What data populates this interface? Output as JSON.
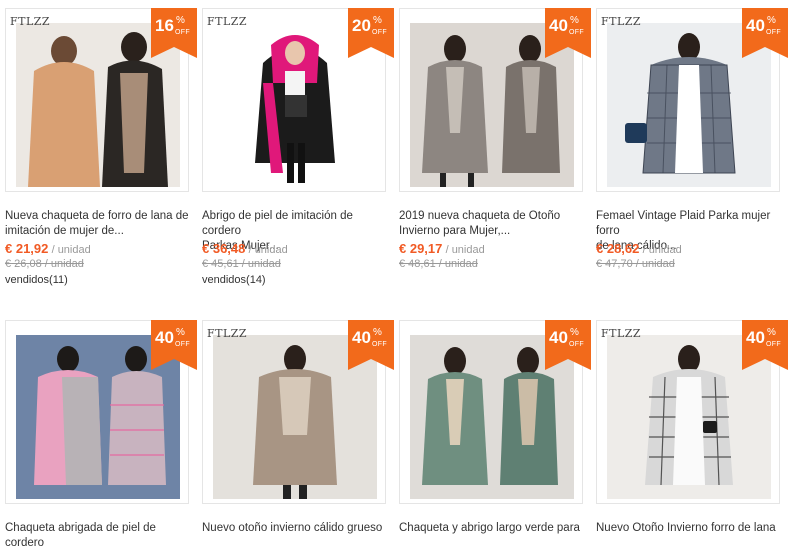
{
  "badge_off_label": "OFF",
  "badge_pct": "%",
  "colors": {
    "accent": "#f26a1b",
    "price": "#f15a24",
    "muted": "#999999"
  },
  "products": [
    {
      "brand": "FTLZZ",
      "discount": "16",
      "title_l1": "Nueva chaqueta de forro de lana de",
      "title_l2": "imitación de mujer de...",
      "price": "€ 21,92",
      "unit": "/ unidad",
      "old_price": "€ 26,08 / unidad",
      "sold": "vendidos(11)"
    },
    {
      "brand": "FTLZZ",
      "discount": "20",
      "title_l1": "Abrigo de piel de imitación de cordero",
      "title_l2": "Parkas Mujer...",
      "price": "€ 36,48",
      "unit": "/ unidad",
      "old_price": "€ 45,61 / unidad",
      "sold": "vendidos(14)"
    },
    {
      "brand": "",
      "discount": "40",
      "title_l1": "2019 nueva chaqueta de Otoño",
      "title_l2": "Invierno para Mujer,...",
      "price": "€ 29,17",
      "unit": "/ unidad",
      "old_price": "€ 48,61 / unidad",
      "sold": ""
    },
    {
      "brand": "FTLZZ",
      "discount": "40",
      "title_l1": "Femael Vintage Plaid Parka mujer forro",
      "title_l2": "de lana cálido...",
      "price": "€ 28,62",
      "unit": "/ unidad",
      "old_price": "€ 47,70 / unidad",
      "sold": ""
    },
    {
      "brand": "",
      "discount": "40",
      "title_l1": "Chaqueta abrigada de piel de cordero",
      "title_l2": ""
    },
    {
      "brand": "FTLZZ",
      "discount": "40",
      "title_l1": "Nuevo otoño invierno cálido grueso",
      "title_l2": ""
    },
    {
      "brand": "",
      "discount": "40",
      "title_l1": "Chaqueta y abrigo largo verde para",
      "title_l2": ""
    },
    {
      "brand": "FTLZZ",
      "discount": "40",
      "title_l1": "Nuevo Otoño Invierno forro de lana",
      "title_l2": ""
    }
  ]
}
